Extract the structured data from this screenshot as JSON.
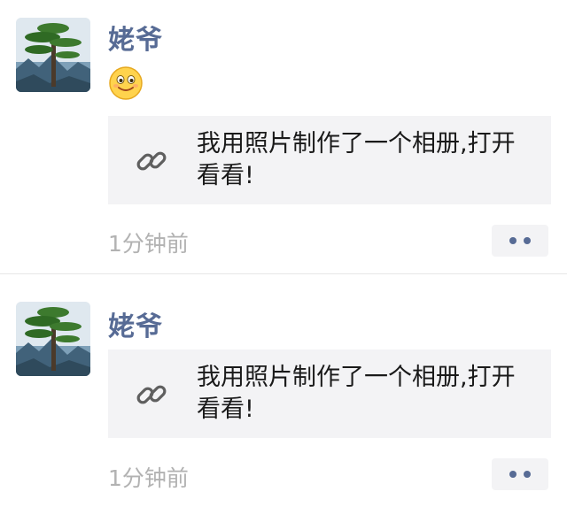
{
  "posts": [
    {
      "author": "姥爷",
      "avatar_icon": "pine-tree-landscape-avatar",
      "emoji_icon": "smile-emoji-icon",
      "link_text": "我用照片制作了一个相册,打开\n看看!",
      "link_icon": "link-icon",
      "time": "1分钟前",
      "more_icon": "more-dots-icon"
    },
    {
      "author": "姥爷",
      "avatar_icon": "pine-tree-landscape-avatar",
      "link_text": "我用照片制作了一个相册,打开\n看看!",
      "link_icon": "link-icon",
      "time": "1分钟前",
      "more_icon": "more-dots-icon"
    }
  ],
  "colors": {
    "name": "#576b95",
    "time": "#b2b2b2",
    "card_bg": "#f3f3f5",
    "text": "#1a1a1a"
  }
}
